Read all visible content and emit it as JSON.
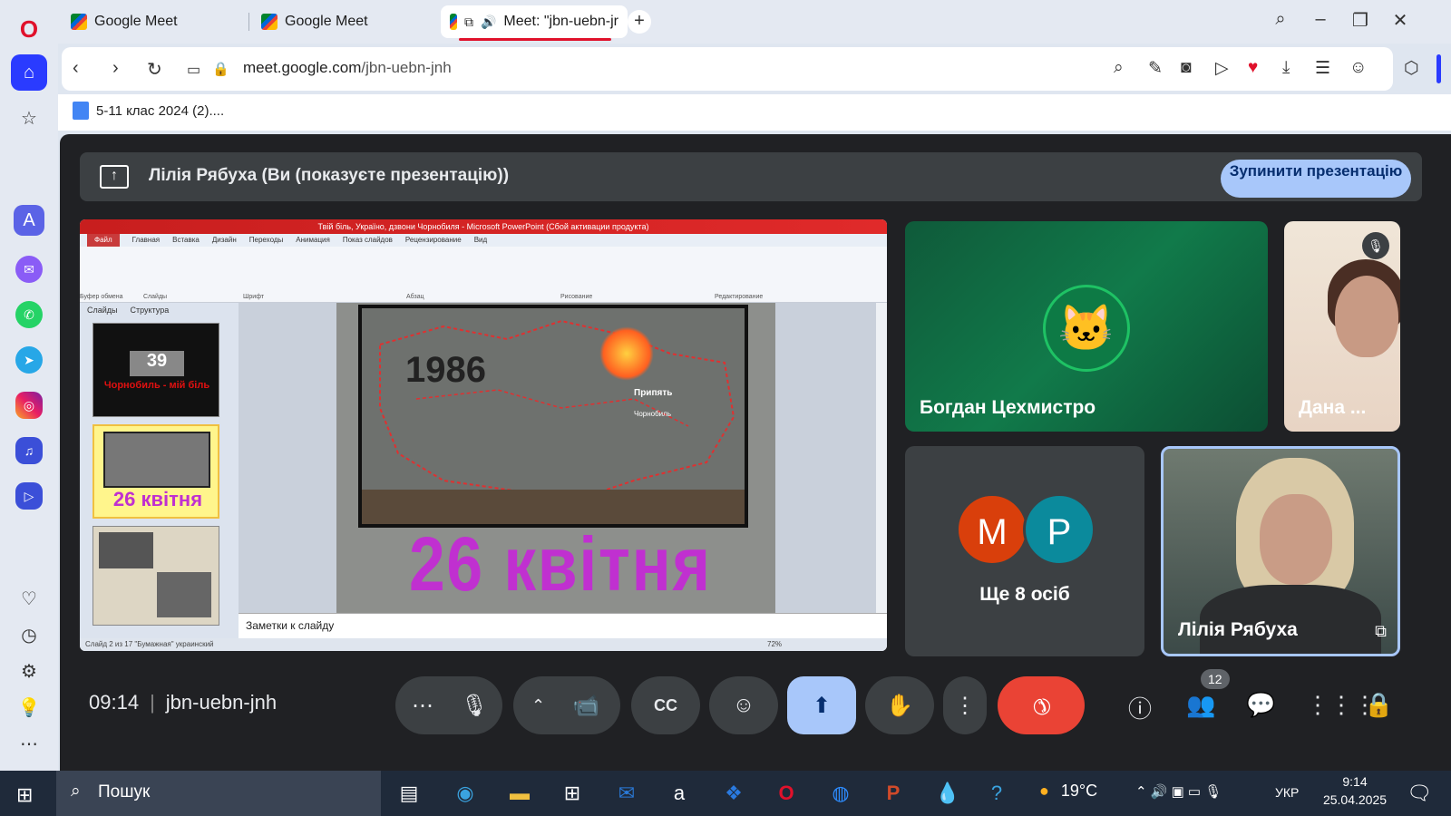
{
  "browser": {
    "tabs": [
      {
        "label": "Google Meet",
        "active": false
      },
      {
        "label": "Google Meet",
        "active": false
      },
      {
        "label": "Meet: \"jbn-uebn-jr",
        "active": true
      }
    ],
    "url_domain": "meet.google.com",
    "url_path": "/jbn-uebn-jnh",
    "bookmark": "5-11 клас 2024 (2)...."
  },
  "meet": {
    "banner_text": "Лілія Рябуха (Ви (показуєте презентацію))",
    "stop_button": "Зупинити презентацію",
    "time": "09:14",
    "meeting_code": "jbn-uebn-jnh",
    "people_count": "12",
    "participants": {
      "bogdan": "Богдан Цехмистро",
      "dana": "Дана ...",
      "others_text": "Ще 8 осіб",
      "others_avatars": [
        {
          "letter": "M",
          "color": "#d93f0b"
        },
        {
          "letter": "P",
          "color": "#0b8a9c"
        }
      ],
      "liliya": "Лілія Рябуха"
    }
  },
  "presentation": {
    "title_bar": "Твій біль, Україно, дзвони Чорнобиля - Microsoft PowerPoint (Сбой активации продукта)",
    "menu_tabs": [
      "Файл",
      "Главная",
      "Вставка",
      "Дизайн",
      "Переходы",
      "Анимация",
      "Показ слайдов",
      "Рецензирование",
      "Вид"
    ],
    "ribbon_groups": [
      "Буфер обмена",
      "Слайды",
      "Шрифт",
      "Абзац",
      "Рисование",
      "Редактирование"
    ],
    "left_tabs": [
      "Слайды",
      "Структура"
    ],
    "thumb1_text": "Чорнобиль - мій біль",
    "thumb2_text": "26 квітня",
    "slide_year": "1986",
    "slide_date": "26  квітня",
    "slide_pripyat": "Припять",
    "slide_chornobyl": "Чорнобиль",
    "notes": "Заметки к слайду",
    "status": "Слайд 2 из 17   \"Бумажная\"   украинский",
    "zoom": "72%"
  },
  "taskbar": {
    "search": "Пошук",
    "temp": "19°C",
    "lang": "УКР",
    "time": "9:14",
    "date": "25.04.2025"
  }
}
